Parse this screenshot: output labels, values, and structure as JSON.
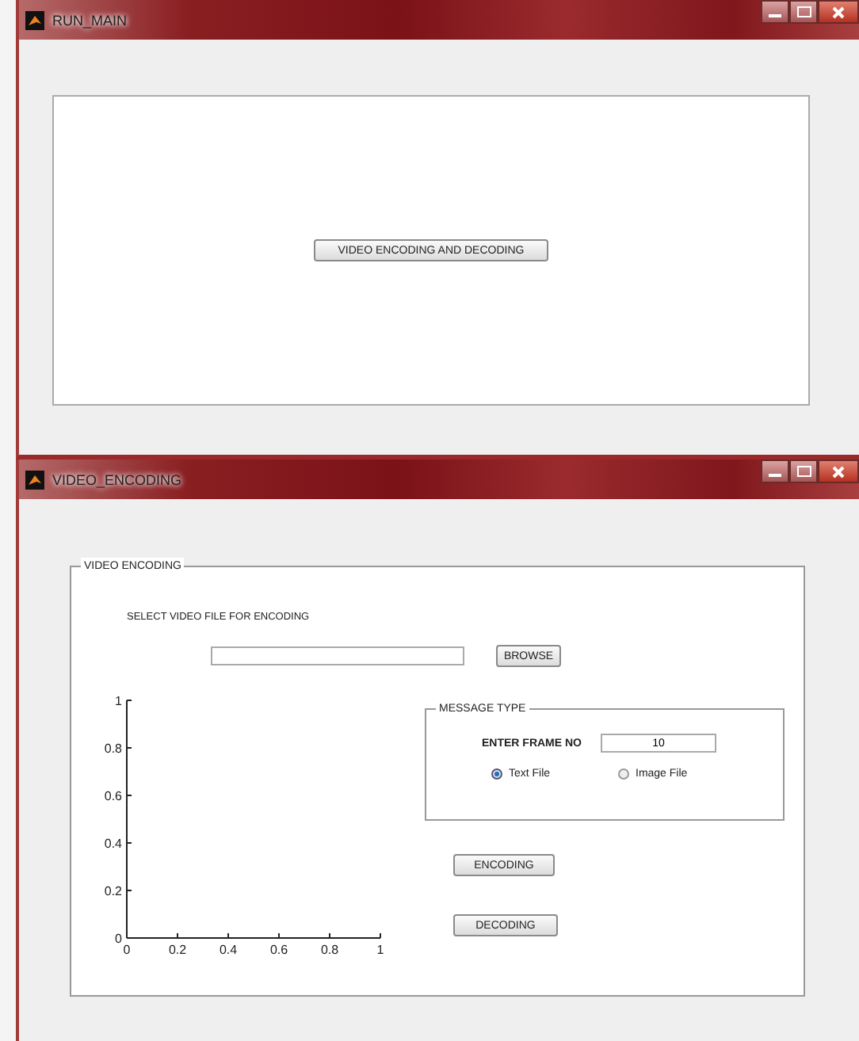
{
  "windows": [
    {
      "title": "RUN_MAIN",
      "buttons": [
        "VIDEO ENCODING AND DECODING"
      ]
    },
    {
      "title": "VIDEO_ENCODING",
      "panel": {
        "title": "VIDEO ENCODING",
        "prompt": "SELECT VIDEO FILE FOR ENCODING",
        "browse_button": "BROWSE",
        "chart_data": {
          "type": "line",
          "xlim": [
            0,
            1
          ],
          "ylim": [
            0,
            1
          ],
          "xticks": [
            0,
            0.2,
            0.4,
            0.6,
            0.8,
            1
          ],
          "yticks": [
            0,
            0.2,
            0.4,
            0.6,
            0.8,
            1
          ]
        },
        "message_type": {
          "title": "MESSAGE TYPE",
          "frame_label": "ENTER FRAME NO",
          "frame_value": "10",
          "options": [
            {
              "label": "Text File",
              "selected": true
            },
            {
              "label": "Image File",
              "selected": false
            }
          ]
        },
        "actions": [
          "ENCODING",
          "DECODING"
        ]
      }
    }
  ]
}
